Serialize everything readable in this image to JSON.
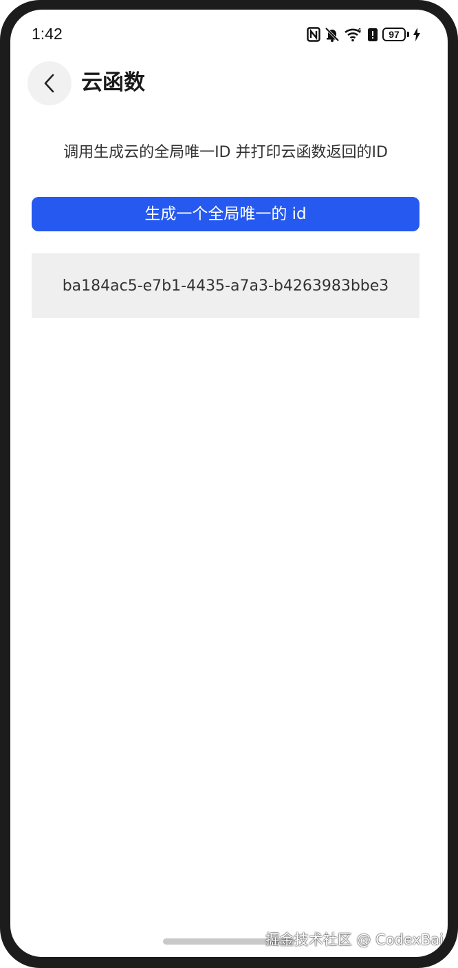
{
  "status_bar": {
    "time": "1:42",
    "battery_level": "97",
    "icons": [
      "nfc-icon",
      "mute-bell-icon",
      "wifi-icon",
      "battery-saver-icon",
      "battery-icon",
      "charging-icon"
    ]
  },
  "header": {
    "back_icon": "chevron-left-icon",
    "title": "云函数"
  },
  "main": {
    "description": "调用生成云的全局唯一ID 并打印云函数返回的ID",
    "generate_button_label": "生成一个全局唯一的 id",
    "result_value": "ba184ac5-e7b1-4435-a7a3-b4263983bbe3"
  },
  "watermark": "掘金技术社区 @ CodexBai",
  "colors": {
    "accent": "#2559ef",
    "result_background": "#efefef",
    "frame": "#1c1c1c"
  }
}
